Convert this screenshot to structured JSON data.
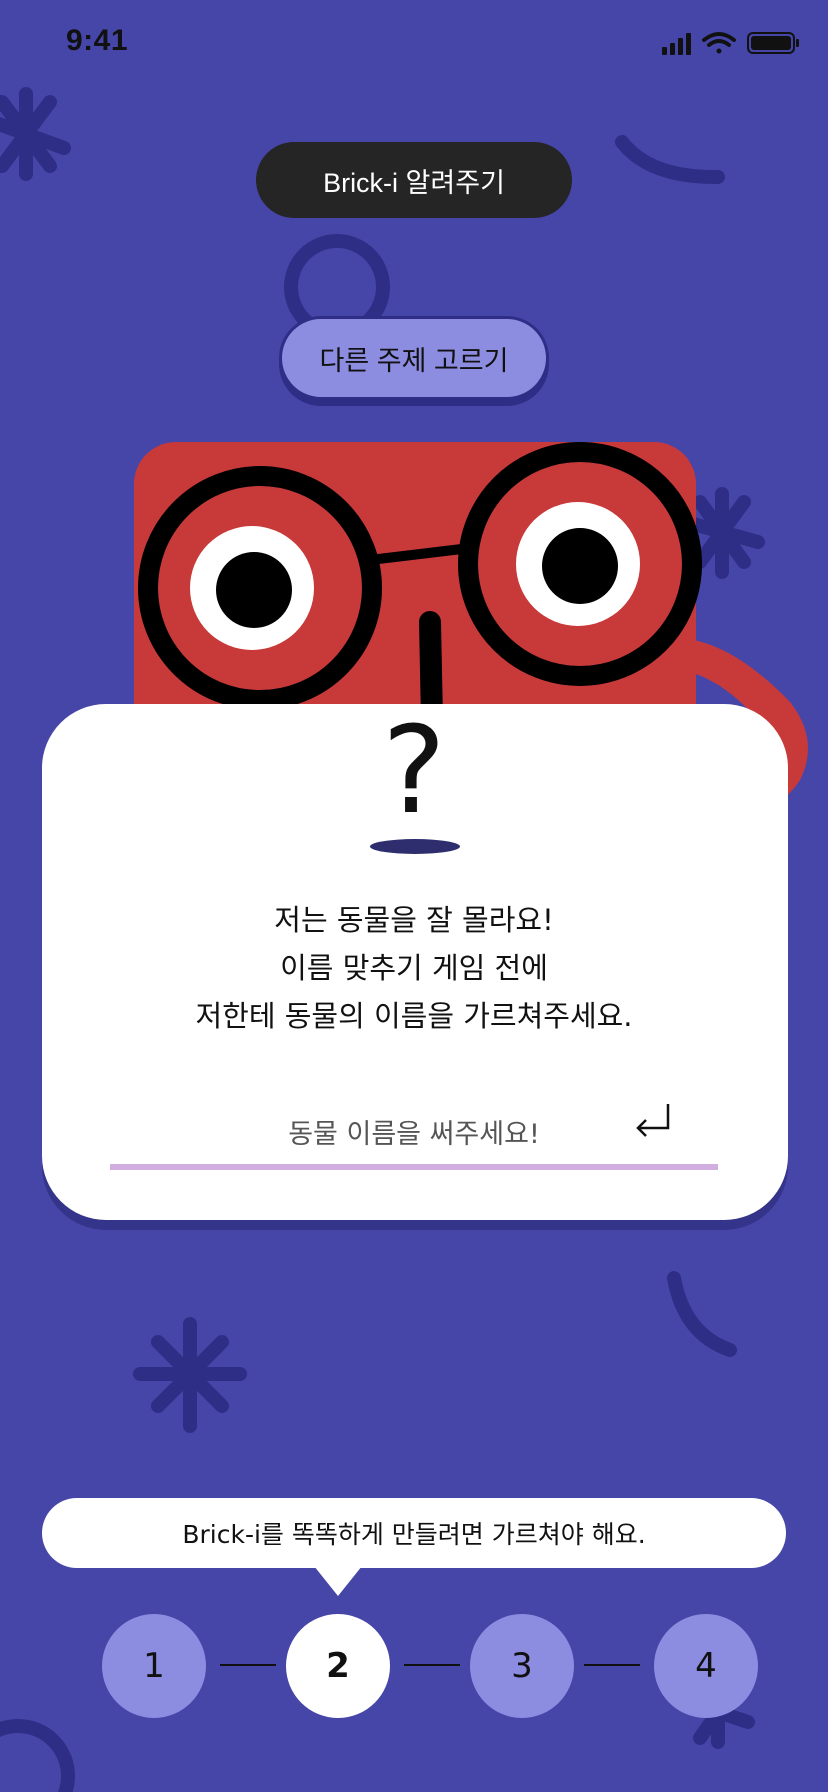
{
  "status_bar": {
    "time": "9:41"
  },
  "top": {
    "teach_button_label": "Brick-i 알려주기",
    "topic_button_label": "다른 주제 고르기"
  },
  "card": {
    "symbol": "?",
    "message_lines": [
      "저는 동물을 잘 몰라요!",
      "이름 맞추기 게임 전에",
      "저한테 동물의 이름을 가르쳐주세요."
    ],
    "input_placeholder": "동물 이름을 써주세요!",
    "input_value": ""
  },
  "hint": {
    "text": "Brick-i를 똑똑하게 만들려면 가르쳐야 해요."
  },
  "steps": {
    "items": [
      {
        "label": "1",
        "active": false
      },
      {
        "label": "2",
        "active": true
      },
      {
        "label": "3",
        "active": false
      },
      {
        "label": "4",
        "active": false
      }
    ]
  },
  "colors": {
    "background": "#4646A9",
    "decoration": "#2E2E86",
    "mascot_red": "#C83A3A",
    "accent_lavender": "#8C8CE0",
    "input_underline": "#D2AEE0",
    "dark_pill": "#252525"
  },
  "icons": {
    "signal": "cellular-signal-icon",
    "wifi": "wifi-icon",
    "battery": "battery-icon",
    "enter": "return-arrow-icon"
  }
}
